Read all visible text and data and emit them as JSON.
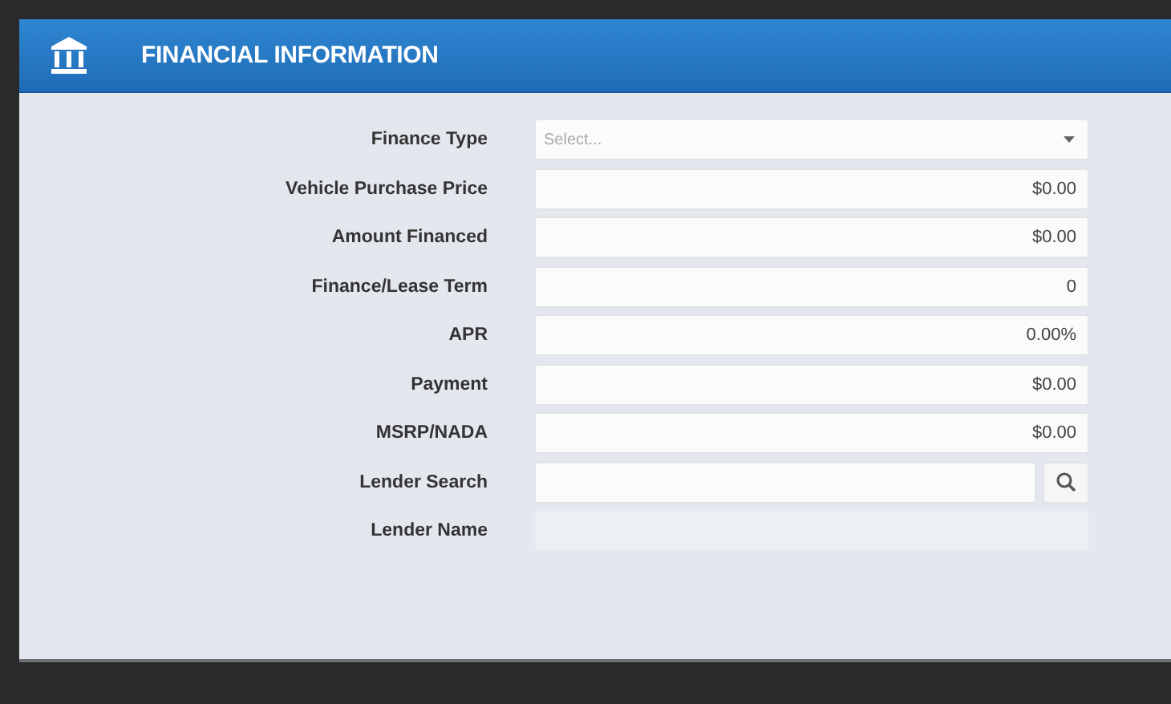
{
  "header": {
    "title": "FINANCIAL INFORMATION"
  },
  "fields": [
    {
      "label": "Finance Type",
      "kind": "select",
      "placeholder": "Select..."
    },
    {
      "label": "Vehicle Purchase Price",
      "kind": "text",
      "value": "$0.00",
      "disabled": false
    },
    {
      "label": "Amount Financed",
      "kind": "text",
      "value": "$0.00",
      "disabled": false
    },
    {
      "label": "Finance/Lease Term",
      "kind": "text",
      "value": "0",
      "disabled": false
    },
    {
      "label": "APR",
      "kind": "text",
      "value": "0.00%",
      "disabled": false
    },
    {
      "label": "Payment",
      "kind": "text",
      "value": "$0.00",
      "disabled": false
    },
    {
      "label": "MSRP/NADA",
      "kind": "text",
      "value": "$0.00",
      "disabled": false
    },
    {
      "label": "Lender Search",
      "kind": "search"
    },
    {
      "label": "Lender Name",
      "kind": "text",
      "disabled": true
    }
  ]
}
